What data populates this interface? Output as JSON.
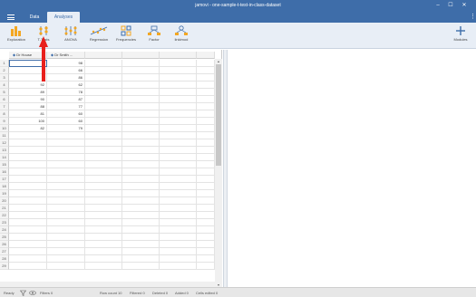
{
  "window": {
    "title": "jamovi - one-sample-t-test-in-class-dataset",
    "controls": {
      "minimize": "–",
      "maximize": "☐",
      "close": "✕"
    }
  },
  "tabs": [
    {
      "label": "Data"
    },
    {
      "label": "Analyses"
    }
  ],
  "ribbon": [
    {
      "label": "Exploration",
      "icon": "exploration-icon"
    },
    {
      "label": "T-Tests",
      "icon": "ttests-icon"
    },
    {
      "label": "ANOVA",
      "icon": "anova-icon"
    },
    {
      "label": "Regression",
      "icon": "regression-icon"
    },
    {
      "label": "Frequencies",
      "icon": "frequencies-icon"
    },
    {
      "label": "Factor",
      "icon": "factor-icon"
    },
    {
      "label": "linkimod",
      "icon": "linkimod-icon"
    },
    {
      "label": "Modules",
      "icon": "modules-icon"
    }
  ],
  "columns": [
    {
      "name": "Dr House"
    },
    {
      "name": "Dr Smith ..."
    }
  ],
  "rows": [
    {
      "n": "1",
      "a": "",
      "b": "98"
    },
    {
      "n": "2",
      "a": "",
      "b": "66"
    },
    {
      "n": "3",
      "a": "",
      "b": "86"
    },
    {
      "n": "4",
      "a": "92",
      "b": "62"
    },
    {
      "n": "5",
      "a": "89",
      "b": "78"
    },
    {
      "n": "6",
      "a": "90",
      "b": "87"
    },
    {
      "n": "7",
      "a": "88",
      "b": "77"
    },
    {
      "n": "8",
      "a": "81",
      "b": "60"
    },
    {
      "n": "9",
      "a": "100",
      "b": "60"
    },
    {
      "n": "10",
      "a": "82",
      "b": "79"
    },
    {
      "n": "11",
      "a": "",
      "b": ""
    },
    {
      "n": "12",
      "a": "",
      "b": ""
    },
    {
      "n": "13",
      "a": "",
      "b": ""
    },
    {
      "n": "14",
      "a": "",
      "b": ""
    },
    {
      "n": "15",
      "a": "",
      "b": ""
    },
    {
      "n": "16",
      "a": "",
      "b": ""
    },
    {
      "n": "17",
      "a": "",
      "b": ""
    },
    {
      "n": "18",
      "a": "",
      "b": ""
    },
    {
      "n": "19",
      "a": "",
      "b": ""
    },
    {
      "n": "20",
      "a": "",
      "b": ""
    },
    {
      "n": "21",
      "a": "",
      "b": ""
    },
    {
      "n": "22",
      "a": "",
      "b": ""
    },
    {
      "n": "23",
      "a": "",
      "b": ""
    },
    {
      "n": "24",
      "a": "",
      "b": ""
    },
    {
      "n": "25",
      "a": "",
      "b": ""
    },
    {
      "n": "26",
      "a": "",
      "b": ""
    },
    {
      "n": "27",
      "a": "",
      "b": ""
    },
    {
      "n": "28",
      "a": "",
      "b": ""
    },
    {
      "n": "29",
      "a": "",
      "b": ""
    }
  ],
  "status": {
    "ready": "Ready",
    "filters": "Filters 0",
    "row_count": "Row count 10",
    "filtered": "Filtered 0",
    "deleted": "Deleted 0",
    "added": "Added 0",
    "cells_edited": "Cells edited 0"
  },
  "colors": {
    "accent": "#3e6da9",
    "ribbon_bg": "#e8eef6",
    "arrow": "#e8201c"
  }
}
